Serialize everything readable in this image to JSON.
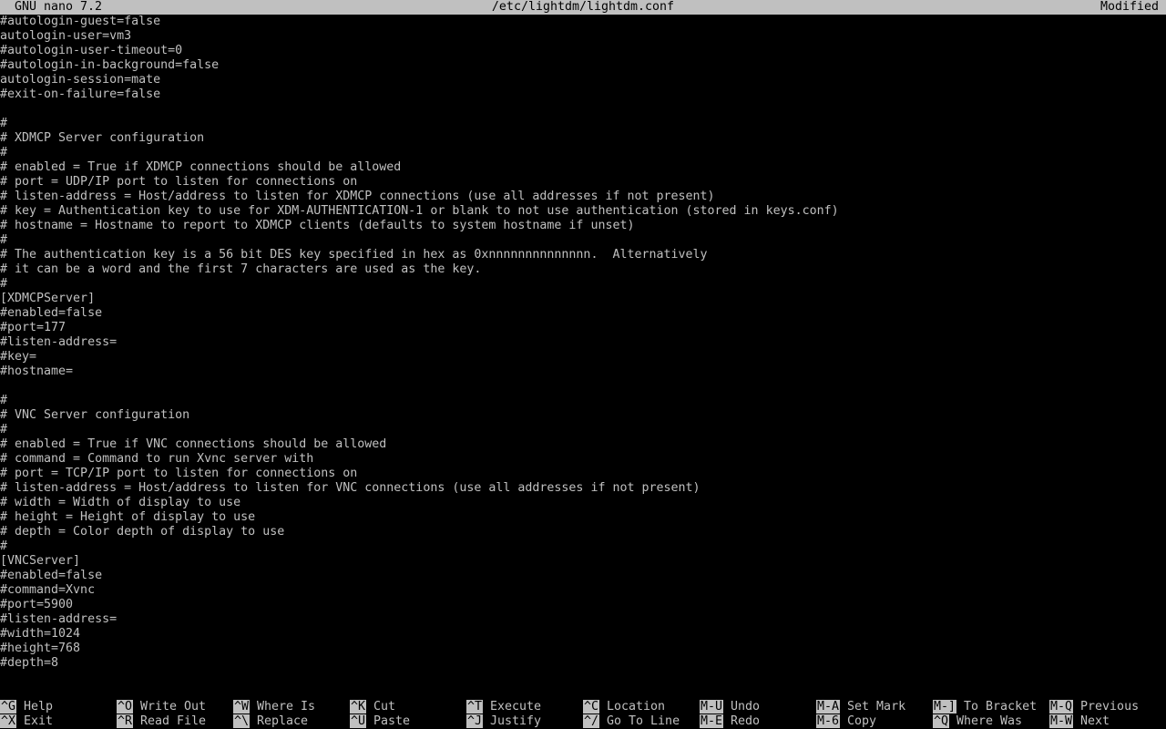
{
  "titlebar": {
    "app": "GNU nano 7.2",
    "file": "/etc/lightdm/lightdm.conf",
    "status": "Modified"
  },
  "lines": [
    "#autologin-guest=false",
    "autologin-user=vm3",
    "#autologin-user-timeout=0",
    "#autologin-in-background=false",
    "autologin-session=mate",
    "#exit-on-failure=false",
    "",
    "#",
    "# XDMCP Server configuration",
    "#",
    "# enabled = True if XDMCP connections should be allowed",
    "# port = UDP/IP port to listen for connections on",
    "# listen-address = Host/address to listen for XDMCP connections (use all addresses if not present)",
    "# key = Authentication key to use for XDM-AUTHENTICATION-1 or blank to not use authentication (stored in keys.conf)",
    "# hostname = Hostname to report to XDMCP clients (defaults to system hostname if unset)",
    "#",
    "# The authentication key is a 56 bit DES key specified in hex as 0xnnnnnnnnnnnnnn.  Alternatively",
    "# it can be a word and the first 7 characters are used as the key.",
    "#",
    "[XDMCPServer]",
    "#enabled=false",
    "#port=177",
    "#listen-address=",
    "#key=",
    "#hostname=",
    "",
    "#",
    "# VNC Server configuration",
    "#",
    "# enabled = True if VNC connections should be allowed",
    "# command = Command to run Xvnc server with",
    "# port = TCP/IP port to listen for connections on",
    "# listen-address = Host/address to listen for VNC connections (use all addresses if not present)",
    "# width = Width of display to use",
    "# height = Height of display to use",
    "# depth = Color depth of display to use",
    "#",
    "[VNCServer]",
    "#enabled=false",
    "#command=Xvnc",
    "#port=5900",
    "#listen-address=",
    "#width=1024",
    "#height=768",
    "#depth=8"
  ],
  "shortcuts": [
    {
      "key": "^G",
      "label": "Help"
    },
    {
      "key": "^X",
      "label": "Exit"
    },
    {
      "key": "^O",
      "label": "Write Out"
    },
    {
      "key": "^R",
      "label": "Read File"
    },
    {
      "key": "^W",
      "label": "Where Is"
    },
    {
      "key": "^\\",
      "label": "Replace"
    },
    {
      "key": "^K",
      "label": "Cut"
    },
    {
      "key": "^U",
      "label": "Paste"
    },
    {
      "key": "^T",
      "label": "Execute"
    },
    {
      "key": "^J",
      "label": "Justify"
    },
    {
      "key": "^C",
      "label": "Location"
    },
    {
      "key": "^/",
      "label": "Go To Line"
    },
    {
      "key": "M-U",
      "label": "Undo"
    },
    {
      "key": "M-E",
      "label": "Redo"
    },
    {
      "key": "M-A",
      "label": "Set Mark"
    },
    {
      "key": "M-6",
      "label": "Copy"
    },
    {
      "key": "M-]",
      "label": "To Bracket"
    },
    {
      "key": "^Q",
      "label": "Where Was"
    },
    {
      "key": "M-Q",
      "label": "Previous"
    },
    {
      "key": "M-W",
      "label": "Next"
    }
  ]
}
